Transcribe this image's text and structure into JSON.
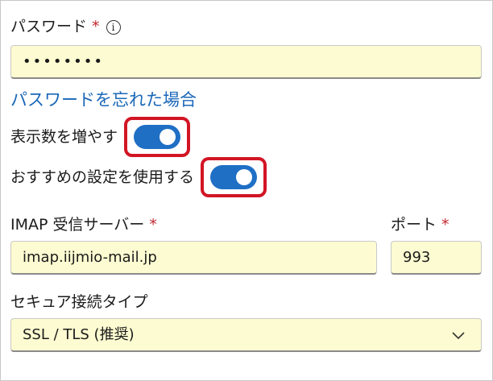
{
  "password": {
    "label": "パスワード",
    "required_mark": "*",
    "info_icon": "info-icon",
    "value": "••••••••"
  },
  "forgot_password_link": "パスワードを忘れた場合",
  "show_more": {
    "label": "表示数を増やす",
    "on": true
  },
  "recommended_settings": {
    "label": "おすすめの設定を使用する",
    "on": true
  },
  "imap_server": {
    "label": "IMAP 受信サーバー",
    "required_mark": "*",
    "value": "imap.iijmio-mail.jp"
  },
  "port": {
    "label": "ポート",
    "required_mark": "*",
    "value": "993"
  },
  "security_type": {
    "label": "セキュア接続タイプ",
    "selected": "SSL / TLS (推奨)",
    "icon": "chevron-down-icon"
  },
  "colors": {
    "accent": "#1f6fc5",
    "link": "#1a67b8",
    "highlight_border": "#d21524",
    "field_bg": "#fdfbd1",
    "required": "#c4262e"
  }
}
